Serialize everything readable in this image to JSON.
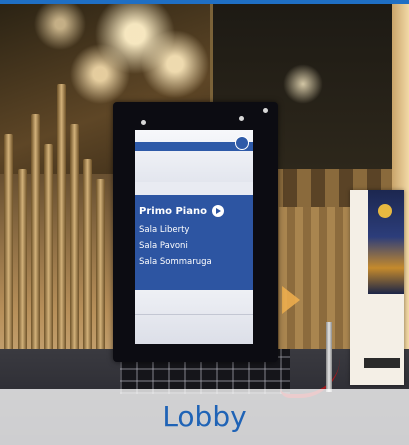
{
  "caption": {
    "label": "Lobby",
    "color": "#1f63b6"
  },
  "signage": {
    "title": "Primo Piano",
    "title_icon": "arrow-right-circle-icon",
    "rooms": [
      {
        "label": "Sala Liberty"
      },
      {
        "label": "Sala Pavoni"
      },
      {
        "label": "Sala Sommaruga"
      }
    ],
    "panel_color": "#2d55a2"
  },
  "colors": {
    "accent_bar": "#1f6fc4",
    "rope": "#a3191d"
  }
}
